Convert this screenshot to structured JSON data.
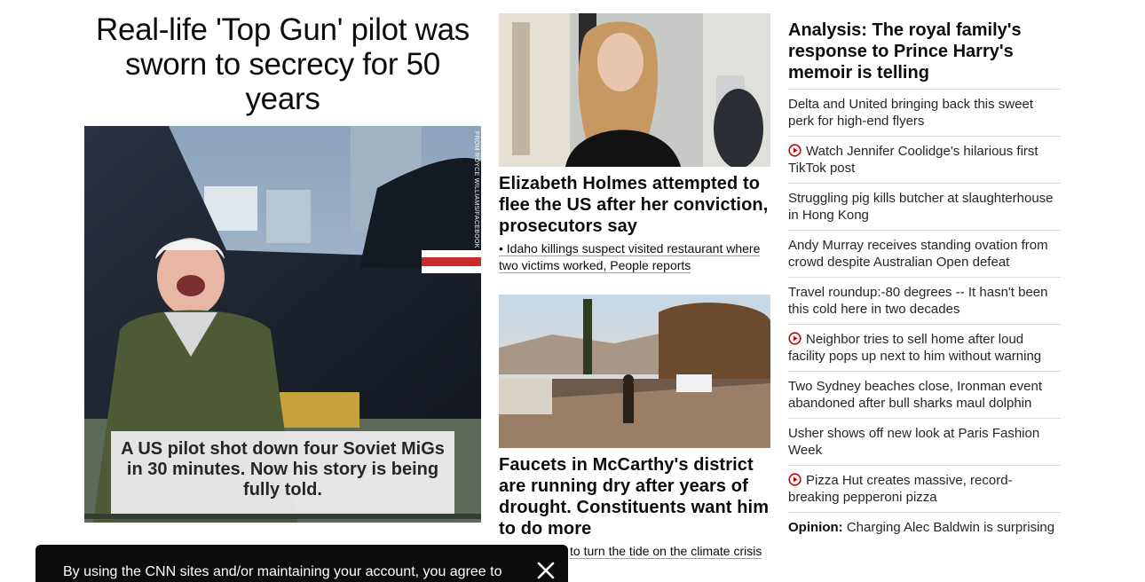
{
  "lead": {
    "headline": "Real-life 'Top Gun' pilot was sworn to secrecy for 50 years",
    "image_credit": "FROM ROYCE WILLIAMS/FACEBOOK",
    "image_caption": "A US pilot shot down four Soviet MiGs in 30 minutes. Now his story is being fully told."
  },
  "middle": {
    "story1": {
      "headline": "Elizabeth Holmes attempted to flee the US after her conviction, prosecutors say",
      "related": "• Idaho killings suspect visited restaurant where two victims worked, People reports"
    },
    "story2": {
      "headline": "Faucets in McCarthy's district are running dry after years of drought. Constituents want him to do more",
      "related_partial": "to turn the tide on the climate crisis"
    }
  },
  "right": {
    "analysis": "Analysis: The royal family's response to Prince Harry's memoir is telling",
    "items": [
      {
        "text": "Delta and United bringing back this sweet perk for high-end flyers",
        "video": false
      },
      {
        "text": "Watch Jennifer Coolidge's hilarious first TikTok post",
        "video": true
      },
      {
        "text": "Struggling pig kills butcher at slaughterhouse in Hong Kong",
        "video": false
      },
      {
        "text": "Andy Murray receives standing ovation from crowd despite Australian Open defeat",
        "video": false
      },
      {
        "text": "Travel roundup:-80 degrees -- It hasn't been this cold here in two decades",
        "video": false
      },
      {
        "text": "Neighbor tries to sell home after loud facility pops up next to him without warning",
        "video": true
      },
      {
        "text": "Two Sydney beaches close, Ironman event abandoned after bull sharks maul dolphin",
        "video": false
      },
      {
        "text": "Usher shows off new look at Paris Fashion Week",
        "video": false
      },
      {
        "text": "Pizza Hut creates massive, record-breaking pepperoni pizza",
        "video": true
      }
    ],
    "opinion_label": "Opinion:",
    "opinion_text": " Charging Alec Baldwin is surprising"
  },
  "cookie": {
    "text": "By using the CNN sites and/or maintaining your account, you agree to"
  },
  "colors": {
    "video_red": "#cc0000",
    "divider": "#dcdcdc",
    "banner_bg": "#0c0c0c"
  },
  "icons": {
    "video": "play-circle-icon",
    "close": "close-icon"
  }
}
